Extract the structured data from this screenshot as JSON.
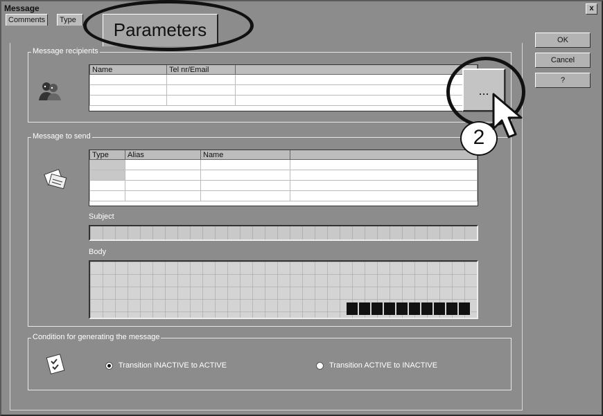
{
  "window": {
    "title": "Message",
    "close_label": "x"
  },
  "tabs": [
    {
      "label": "Comments"
    },
    {
      "label": "Type"
    },
    {
      "label": "Parameters"
    }
  ],
  "buttons": {
    "ok": "OK",
    "cancel": "Cancel",
    "help": "?",
    "browse": "..."
  },
  "recipients": {
    "group_label": "Message recipients",
    "columns": [
      "Name",
      "Tel nr/Email"
    ]
  },
  "message": {
    "group_label": "Message to send",
    "columns": [
      "Type",
      "Alias",
      "Name"
    ],
    "subject_label": "Subject",
    "body_label": "Body"
  },
  "condition": {
    "group_label": "Condition for generating the message",
    "option_1": "Transition INACTIVE to ACTIVE",
    "option_2": "Transition ACTIVE to INACTIVE",
    "selected": "option_1"
  },
  "annotation": {
    "step_number": "2"
  },
  "icons": [
    "people-icon",
    "message-icon",
    "checklist-icon",
    "cursor-arrow-icon"
  ]
}
